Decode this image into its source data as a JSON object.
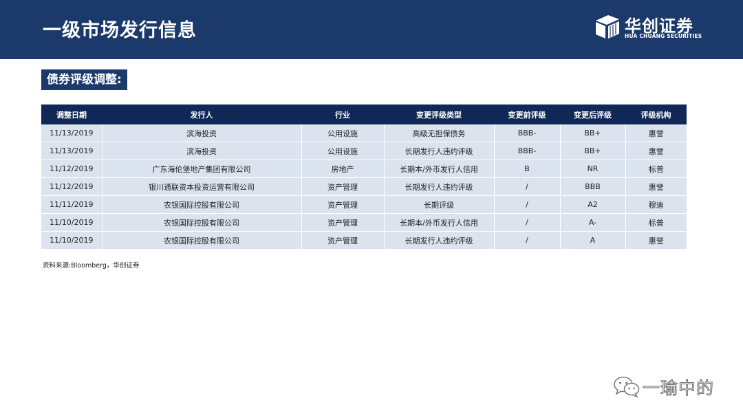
{
  "header": {
    "title": "一级市场发行信息",
    "logo_name": "华创证券",
    "logo_en": "HUA CHUANG SECURITIES"
  },
  "section": {
    "title": "债券评级调整:"
  },
  "table": {
    "columns": [
      "调整日期",
      "发行人",
      "行业",
      "变更评级类型",
      "变更前评级",
      "变更后评级",
      "评级机构"
    ],
    "rows": [
      [
        "11/13/2019",
        "滨海投资",
        "公用设施",
        "高级无担保债务",
        "BBB-",
        "BB+",
        "惠誉"
      ],
      [
        "11/13/2019",
        "滨海投资",
        "公用设施",
        "长期发行人违约评级",
        "BBB-",
        "BB+",
        "惠誉"
      ],
      [
        "11/12/2019",
        "广东海伦堡地产集团有限公司",
        "房地产",
        "长期本/外币发行人信用",
        "B",
        "NR",
        "标普"
      ],
      [
        "11/12/2019",
        "银川通联资本投资运营有限公司",
        "资产管理",
        "长期发行人违约评级",
        "/",
        "BBB",
        "惠誉"
      ],
      [
        "11/11/2019",
        "农银国际控股有限公司",
        "资产管理",
        "长期评级",
        "/",
        "A2",
        "穆迪"
      ],
      [
        "11/10/2019",
        "农银国际控股有限公司",
        "资产管理",
        "长期本/外币发行人信用",
        "/",
        "A-",
        "标普"
      ],
      [
        "11/10/2019",
        "农银国际控股有限公司",
        "资产管理",
        "长期发行人违约评级",
        "/",
        "A",
        "惠誉"
      ]
    ]
  },
  "source": "资料来源:Bloomberg，华创证券",
  "watermark": {
    "text": "一瑜中的"
  },
  "colors": {
    "header_bg": "#1b3a6b",
    "table_header_bg": "#0f2856",
    "row_bg": "#dbe3ee"
  }
}
